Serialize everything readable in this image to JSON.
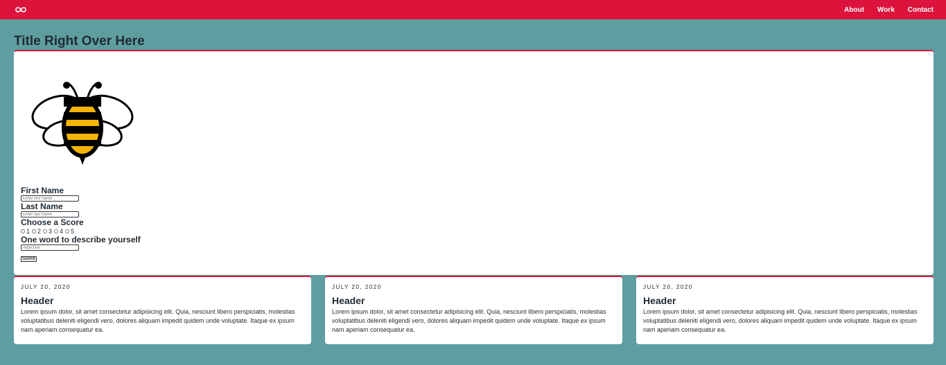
{
  "nav": {
    "logo_icon": "infinity-icon",
    "links": [
      "About",
      "Work",
      "Contact"
    ]
  },
  "colors": {
    "accent": "#dc143c",
    "background": "#5f9ea0"
  },
  "main": {
    "title": "Title Right Over Here",
    "image_icon": "bee-icon",
    "form": {
      "first_name_label": "First Name",
      "first_name_placeholder": "Enter first name",
      "last_name_label": "Last Name",
      "last_name_placeholder": "Enter last name",
      "score_label": "Choose a Score",
      "score_options": [
        "1",
        "2",
        "3",
        "4",
        "5"
      ],
      "word_label": "One word to describe yourself",
      "word_placeholder": "Adjective",
      "submit_label": "Submit"
    }
  },
  "cards": [
    {
      "date": "JULY 20, 2020",
      "header": "Header",
      "body": "Lorem ipsum dolor, sit amet consectetur adipisicing elit. Quia, nesciunt libero perspiciatis, molestias voluptatibus deleniti eligendi vero, dolores aliquam impedit quidem unde voluptate. Itaque ex ipsum nam aperiam consequatur ea."
    },
    {
      "date": "JULY 20, 2020",
      "header": "Header",
      "body": "Lorem ipsum dolor, sit amet consectetur adipisicing elit. Quia, nesciunt libero perspiciatis, molestias voluptatibus deleniti eligendi vero, dolores aliquam impedit quidem unde voluptate. Itaque ex ipsum nam aperiam consequatur ea."
    },
    {
      "date": "JULY 20, 2020",
      "header": "Header",
      "body": "Lorem ipsum dolor, sit amet consectetur adipisicing elit. Quia, nesciunt libero perspiciatis, molestias voluptatibus deleniti eligendi vero, dolores aliquam impedit quidem unde voluptate. Itaque ex ipsum nam aperiam consequatur ea."
    }
  ]
}
